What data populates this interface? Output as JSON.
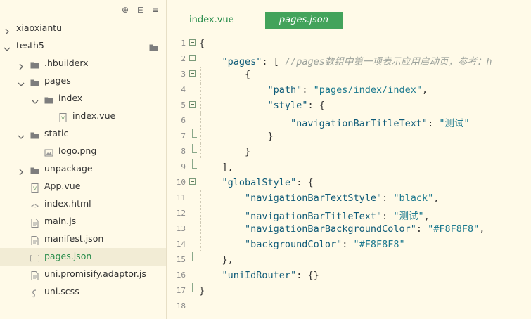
{
  "sidebar": {
    "items": [
      {
        "label": "xiaoxiantu",
        "indent": 0,
        "chevron": "right",
        "icon": "none"
      },
      {
        "label": "testh5",
        "indent": 0,
        "chevron": "down",
        "icon": "none"
      },
      {
        "label": ".hbuilderx",
        "indent": 1,
        "chevron": "right",
        "icon": "folder"
      },
      {
        "label": "pages",
        "indent": 1,
        "chevron": "down",
        "icon": "folder"
      },
      {
        "label": "index",
        "indent": 2,
        "chevron": "down",
        "icon": "folder"
      },
      {
        "label": "index.vue",
        "indent": 3,
        "chevron": "none",
        "icon": "vue-file"
      },
      {
        "label": "static",
        "indent": 1,
        "chevron": "down",
        "icon": "folder"
      },
      {
        "label": "logo.png",
        "indent": 2,
        "chevron": "none",
        "icon": "image-file"
      },
      {
        "label": "unpackage",
        "indent": 1,
        "chevron": "right",
        "icon": "folder"
      },
      {
        "label": "App.vue",
        "indent": 1,
        "chevron": "none",
        "icon": "vue-file"
      },
      {
        "label": "index.html",
        "indent": 1,
        "chevron": "none",
        "icon": "html-file"
      },
      {
        "label": "main.js",
        "indent": 1,
        "chevron": "none",
        "icon": "js-file"
      },
      {
        "label": "manifest.json",
        "indent": 1,
        "chevron": "none",
        "icon": "js-file"
      },
      {
        "label": "pages.json",
        "indent": 1,
        "chevron": "none",
        "icon": "json-file",
        "selected": true
      },
      {
        "label": "uni.promisify.adaptor.js",
        "indent": 1,
        "chevron": "none",
        "icon": "js-file"
      },
      {
        "label": "uni.scss",
        "indent": 1,
        "chevron": "none",
        "icon": "scss-file"
      }
    ]
  },
  "editor": {
    "tabs": [
      {
        "label": "index.vue",
        "active": false
      },
      {
        "label": "pages.json",
        "active": true
      }
    ],
    "lines": [
      {
        "n": "1",
        "fold": "open",
        "depth": 0,
        "tokens": [
          [
            "p",
            "{"
          ]
        ]
      },
      {
        "n": "2",
        "fold": "open",
        "depth": 1,
        "tokens": [
          [
            "k",
            "\"pages\""
          ],
          [
            "p",
            ": [ "
          ],
          [
            "c",
            "//pages数组中第一项表示应用启动页，参考：h"
          ]
        ]
      },
      {
        "n": "3",
        "fold": "open",
        "depth": 2,
        "tokens": [
          [
            "p",
            "{"
          ]
        ]
      },
      {
        "n": "4",
        "fold": "none",
        "depth": 3,
        "tokens": [
          [
            "k",
            "\"path\""
          ],
          [
            "p",
            ": "
          ],
          [
            "s",
            "\"pages/index/index\""
          ],
          [
            "p",
            ","
          ]
        ]
      },
      {
        "n": "5",
        "fold": "open",
        "depth": 3,
        "tokens": [
          [
            "k",
            "\"style\""
          ],
          [
            "p",
            ": {"
          ]
        ]
      },
      {
        "n": "6",
        "fold": "none",
        "depth": 4,
        "tokens": [
          [
            "k",
            "\"navigationBarTitleText\""
          ],
          [
            "p",
            ": "
          ],
          [
            "s",
            "\"测试\""
          ]
        ]
      },
      {
        "n": "7",
        "fold": "end",
        "depth": 3,
        "tokens": [
          [
            "p",
            "}"
          ]
        ]
      },
      {
        "n": "8",
        "fold": "end",
        "depth": 2,
        "tokens": [
          [
            "p",
            "}"
          ]
        ]
      },
      {
        "n": "9",
        "fold": "end",
        "depth": 1,
        "tokens": [
          [
            "p",
            "],"
          ]
        ]
      },
      {
        "n": "10",
        "fold": "open",
        "depth": 1,
        "tokens": [
          [
            "k",
            "\"globalStyle\""
          ],
          [
            "p",
            ": {"
          ]
        ]
      },
      {
        "n": "11",
        "fold": "none",
        "depth": 2,
        "tokens": [
          [
            "k",
            "\"navigationBarTextStyle\""
          ],
          [
            "p",
            ": "
          ],
          [
            "s",
            "\"black\""
          ],
          [
            "p",
            ","
          ]
        ]
      },
      {
        "n": "12",
        "fold": "none",
        "depth": 2,
        "tokens": [
          [
            "k",
            "\"navigationBarTitleText\""
          ],
          [
            "p",
            ": "
          ],
          [
            "s",
            "\"测试\""
          ],
          [
            "p",
            ","
          ]
        ]
      },
      {
        "n": "13",
        "fold": "none",
        "depth": 2,
        "tokens": [
          [
            "k",
            "\"navigationBarBackgroundColor\""
          ],
          [
            "p",
            ": "
          ],
          [
            "s",
            "\"#F8F8F8\""
          ],
          [
            "p",
            ","
          ]
        ]
      },
      {
        "n": "14",
        "fold": "none",
        "depth": 2,
        "tokens": [
          [
            "k",
            "\"backgroundColor\""
          ],
          [
            "p",
            ": "
          ],
          [
            "s",
            "\"#F8F8F8\""
          ]
        ]
      },
      {
        "n": "15",
        "fold": "end",
        "depth": 1,
        "tokens": [
          [
            "p",
            "},"
          ]
        ]
      },
      {
        "n": "16",
        "fold": "none",
        "depth": 1,
        "tokens": [
          [
            "k",
            "\"uniIdRouter\""
          ],
          [
            "p",
            ": {}"
          ]
        ]
      },
      {
        "n": "17",
        "fold": "end",
        "depth": 0,
        "tokens": [
          [
            "p",
            "}"
          ]
        ]
      },
      {
        "n": "18",
        "fold": "none",
        "depth": 0,
        "tokens": []
      }
    ]
  },
  "colors": {
    "accent": "#43a35b",
    "background": "#fffae8",
    "selected": "#f2ecd5"
  }
}
